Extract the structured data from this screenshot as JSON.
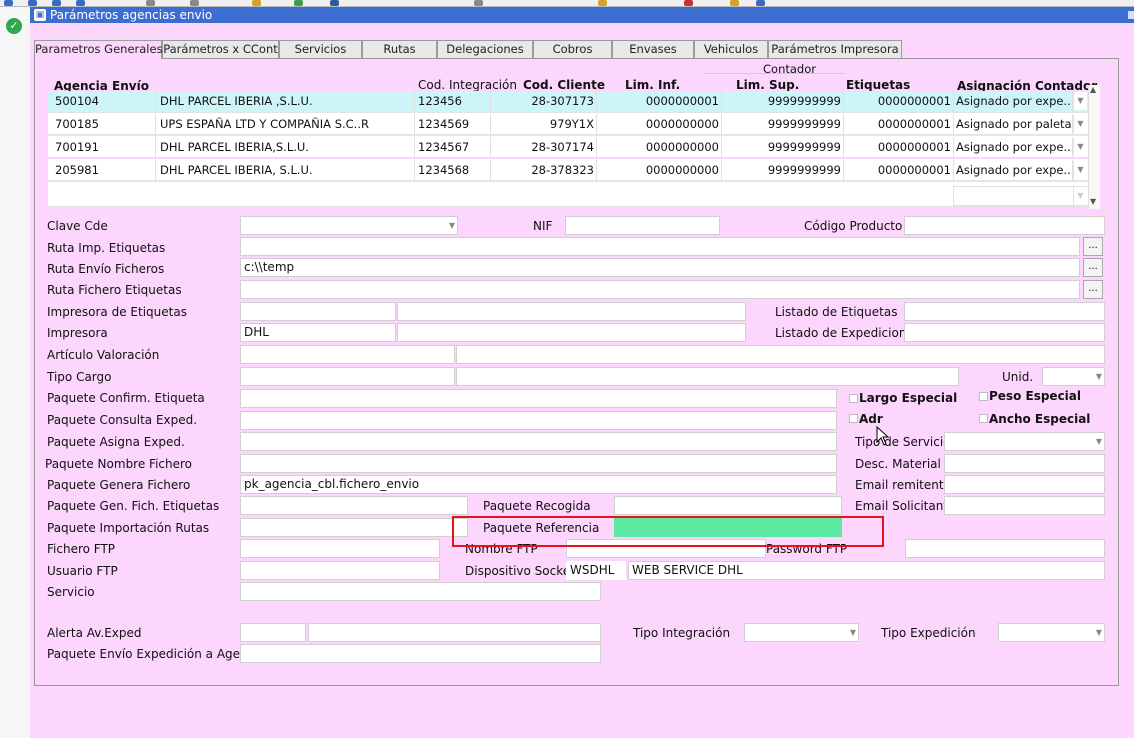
{
  "window": {
    "title": "Parámetros agencias envio"
  },
  "tabs": [
    "Parametros Generales",
    "Parámetros x CCont",
    "Servicios",
    "Rutas",
    "Delegaciones",
    "Cobros",
    "Envases",
    "Vehiculos",
    "Parámetros Impresora"
  ],
  "table": {
    "group_header": "Contador",
    "columns": {
      "agencia": "Agencia Envío",
      "cod_int": "Cod. Integración",
      "cod_cliente": "Cod. Cliente",
      "lim_inf": "Lim. Inf.",
      "lim_sup": "Lim. Sup.",
      "etiquetas": "Etiquetas",
      "asignacion": "Asignación Contador"
    },
    "rows": [
      {
        "agencia": "500104",
        "nombre": "DHL PARCEL IBERIA ,S.L.U.",
        "cod_int": "123456",
        "cod_cliente": "28-307173",
        "lim_inf": "0000000001",
        "lim_sup": "9999999999",
        "etiquetas": "0000000001",
        "asignacion": "Asignado por expe..."
      },
      {
        "agencia": "700185",
        "nombre": "UPS ESPAÑA LTD Y COMPAÑIA S.C..R",
        "cod_int": "1234569",
        "cod_cliente": "979Y1X",
        "lim_inf": "0000000000",
        "lim_sup": "9999999999",
        "etiquetas": "0000000001",
        "asignacion": "Asignado por paleta"
      },
      {
        "agencia": "700191",
        "nombre": "DHL PARCEL IBERIA,S.L.U.",
        "cod_int": "1234567",
        "cod_cliente": "28-307174",
        "lim_inf": "0000000000",
        "lim_sup": "9999999999",
        "etiquetas": "0000000001",
        "asignacion": "Asignado por expe..."
      },
      {
        "agencia": "205981",
        "nombre": "DHL PARCEL IBERIA, S.L.U.",
        "cod_int": "1234568",
        "cod_cliente": "28-378323",
        "lim_inf": "0000000000",
        "lim_sup": "9999999999",
        "etiquetas": "0000000001",
        "asignacion": "Asignado por expe..."
      }
    ]
  },
  "form": {
    "clave_cde": "Clave Cde",
    "nif": "NIF",
    "codigo_producto": "Código Producto",
    "ruta_imp_etiquetas": "Ruta Imp. Etiquetas",
    "ruta_envio_ficheros": "Ruta Envío Ficheros",
    "ruta_envio_ficheros_value": "c:\\\\temp",
    "ruta_fichero_etiquetas": "Ruta Fichero Etiquetas",
    "impresora_etiquetas": "Impresora de Etiquetas",
    "listado_etiquetas": "Listado de Etiquetas",
    "impresora": "Impresora",
    "impresora_value": "DHL",
    "listado_expediciones": "Listado de Expediciones",
    "articulo_valoracion": "Artículo Valoración",
    "tipo_cargo": "Tipo Cargo",
    "unid": "Unid.",
    "paquete_confirm_etiqueta": "Paquete Confirm. Etiqueta",
    "largo_especial": "Largo Especial",
    "peso_especial": "Peso Especial",
    "paquete_consulta_exped": "Paquete Consulta Exped.",
    "adr": "Adr",
    "ancho_especial": "Ancho Especial",
    "paquete_asigna_exped": "Paquete Asigna Exped.",
    "tipo_servicio": "Tipo de Servicio",
    "paquete_nombre_fichero": "Paquete Nombre Fichero",
    "desc_material": "Desc. Material",
    "paquete_genera_fichero": "Paquete Genera Fichero",
    "paquete_genera_fichero_value": "pk_agencia_cbl.fichero_envio",
    "email_remitente": "Email remitente",
    "paquete_gen_fich_etiquetas": "Paquete Gen. Fich. Etiquetas",
    "paquete_recogida": "Paquete Recogida",
    "email_solicitante": "Email Solicitante",
    "paquete_importacion_rutas": "Paquete Importación Rutas",
    "paquete_referencia": "Paquete Referencia",
    "fichero_ftp": "Fichero FTP",
    "nombre_ftp": "Nombre FTP",
    "password_ftp": "Password FTP",
    "usuario_ftp": "Usuario FTP",
    "dispositivo_socket": "Dispositivo Socket",
    "dispositivo_socket_code": "WSDHL",
    "dispositivo_socket_desc": "WEB SERVICE DHL",
    "servicio": "Servicio",
    "alerta_av_exped": "Alerta Av.Exped",
    "tipo_integracion": "Tipo Integración",
    "tipo_expedicion": "Tipo Expedición",
    "paquete_envio_expedicion": "Paquete Envío Expedición a Agencia"
  },
  "colors": {
    "background": "#fcd6fc",
    "title_bar": "#3b6ed0",
    "selected_row": "#cdf5f8",
    "highlight_field": "#5de8a2",
    "annotation_box": "#e0161c"
  }
}
